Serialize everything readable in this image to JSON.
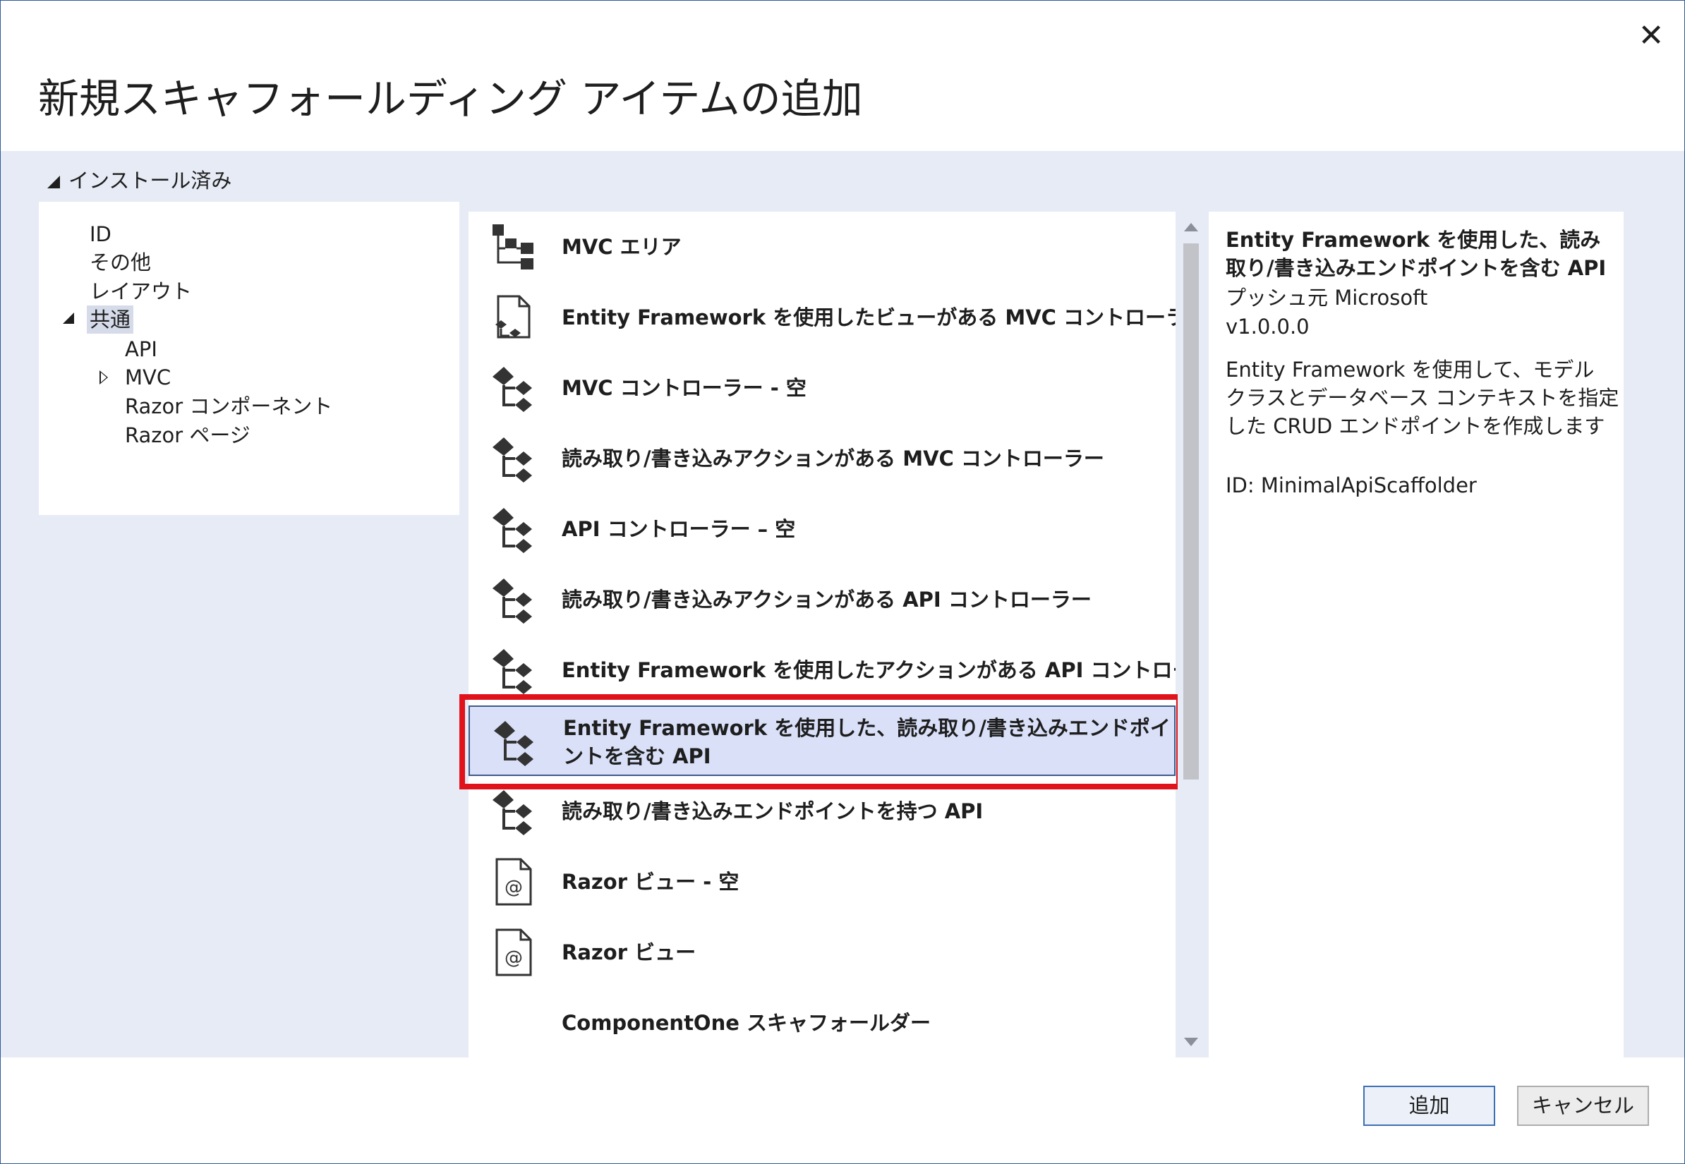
{
  "dialog": {
    "title": "新規スキャフォールディング アイテムの追加",
    "close_glyph": "✕"
  },
  "installed_header": "インストール済み",
  "tree": {
    "items": [
      {
        "label": "ID"
      },
      {
        "label": "その他"
      },
      {
        "label": "レイアウト"
      },
      {
        "label": "共通",
        "selected": true,
        "expanded": true
      },
      {
        "label": "API"
      },
      {
        "label": "MVC",
        "expandable": true
      },
      {
        "label": "Razor コンポーネント"
      },
      {
        "label": "Razor ページ"
      }
    ]
  },
  "list": {
    "items": [
      {
        "label": "MVC エリア",
        "icon": "area-icon"
      },
      {
        "label": "Entity Framework を使用したビューがある MVC コントローラー",
        "icon": "view-controller-icon"
      },
      {
        "label": "MVC コントローラー - 空",
        "icon": "controller-icon"
      },
      {
        "label": "読み取り/書き込みアクションがある MVC コントローラー",
        "icon": "controller-icon"
      },
      {
        "label": "API コントローラー – 空",
        "icon": "controller-icon"
      },
      {
        "label": "読み取り/書き込みアクションがある API コントローラー",
        "icon": "controller-icon"
      },
      {
        "label": "Entity Framework を使用したアクションがある API コントローラー",
        "icon": "controller-icon"
      },
      {
        "label": "Entity Framework を使用した、読み取り/書き込みエンドポイントを含む API",
        "icon": "controller-icon",
        "selected": true
      },
      {
        "label": "読み取り/書き込みエンドポイントを持つ API",
        "icon": "controller-icon"
      },
      {
        "label": "Razor ビュー - 空",
        "icon": "razor-view-icon"
      },
      {
        "label": "Razor ビュー",
        "icon": "razor-view-icon"
      },
      {
        "label": "ComponentOne スキャフォールダー",
        "icon": ""
      }
    ]
  },
  "details": {
    "title": "Entity Framework を使用した、読み取り/書き込みエンドポイントを含む API",
    "publisher": "プッシュ元 Microsoft",
    "version": "v1.0.0.0",
    "description": "Entity Framework を使用して、モデル クラスとデータベース コンテキストを指定した CRUD エンドポイントを作成します",
    "id": "ID: MinimalApiScaffolder"
  },
  "buttons": {
    "add": "追加",
    "cancel": "キャンセル"
  },
  "colors": {
    "band": "#e6ebf5",
    "selection": "#d9e0f8",
    "highlight": "#e0121b",
    "accent_border": "#3c6fb4"
  }
}
